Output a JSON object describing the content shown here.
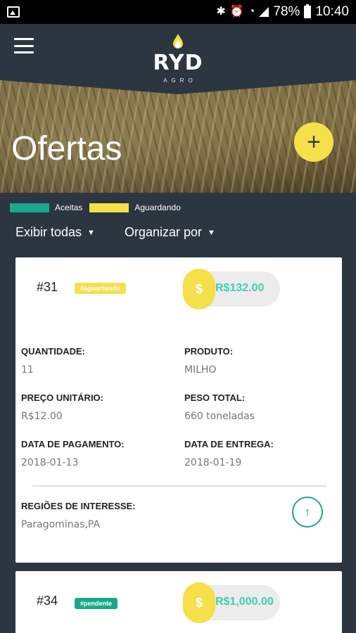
{
  "status_bar": {
    "battery_percent": "78%",
    "time": "10:40",
    "icons": [
      "gallery-icon",
      "bluetooth-icon",
      "alarm-icon",
      "wifi-icon",
      "signal-icon",
      "battery-icon"
    ]
  },
  "header": {
    "logo_text": "RYD",
    "logo_sub": "AGRO",
    "title": "Ofertas",
    "add_label": "+"
  },
  "legend": [
    {
      "label": "Aceitas",
      "color": "#1aa88c"
    },
    {
      "label": "Aguardando",
      "color": "#f5e04a"
    }
  ],
  "filters": {
    "show_label": "Exibir todas",
    "sort_label": "Organizar por"
  },
  "colors": {
    "background": "#2b3641",
    "accent_yellow": "#f5e04a",
    "accent_green": "#1aa88c",
    "price_text": "#3fd0b0"
  },
  "offers": [
    {
      "id": "#31",
      "status": "#aguardando",
      "status_color": "#f5e04a",
      "price": "R$132.00",
      "coin_symbol": "$",
      "quantity_label": "QUANTIDADE:",
      "quantity": "11",
      "product_label": "PRODUTO:",
      "product": "MILHO",
      "unit_price_label": "PREÇO UNITÁRIO:",
      "unit_price": "R$12.00",
      "total_weight_label": "PESO TOTAL:",
      "total_weight": "660 toneladas",
      "payment_date_label": "DATA DE PAGAMENTO:",
      "payment_date": "2018-01-13",
      "delivery_date_label": "DATA DE ENTREGA:",
      "delivery_date": "2018-01-19",
      "regions_label": "REGIÕES DE INTERESSE:",
      "regions": "Paragominas,PA"
    },
    {
      "id": "#34",
      "status": "#pendente",
      "status_color": "#1aa88c",
      "price": "R$1,000.00",
      "coin_symbol": "$"
    }
  ]
}
